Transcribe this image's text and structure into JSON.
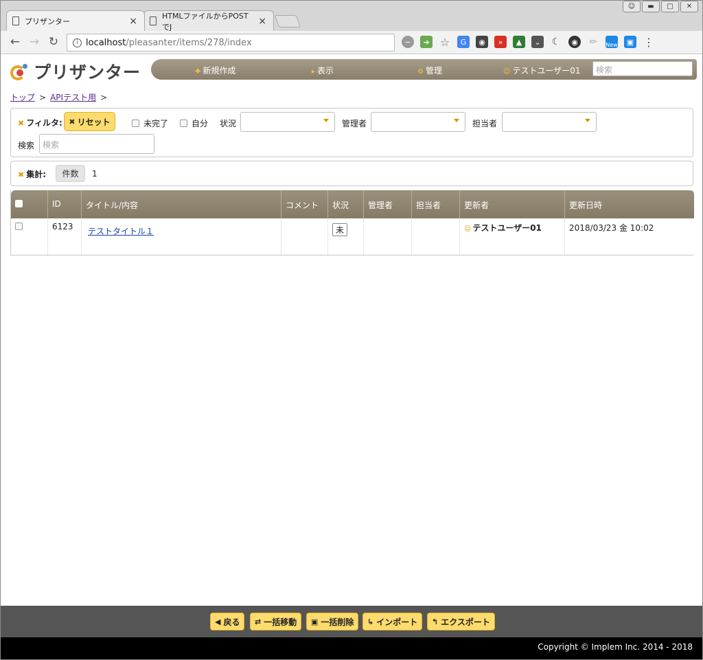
{
  "browser": {
    "tabs": [
      {
        "title": "プリザンター",
        "close": "×"
      },
      {
        "title": "HTMLファイルからPOSTでJ",
        "close": "×"
      }
    ],
    "url_host": "localhost",
    "url_path": "/pleasanter/items/278/index",
    "extensions": [
      {
        "icon": "dash-icon",
        "color": "#9a9a9a"
      },
      {
        "icon": "arrow-ext-icon",
        "color": "#6aa84f"
      },
      {
        "icon": "star-icon",
        "color": "#666666"
      },
      {
        "icon": "translate-icon",
        "color": "#4285f4"
      },
      {
        "icon": "keyhole-icon",
        "color": "#444444"
      },
      {
        "icon": "pocket-red-icon",
        "color": "#d93025"
      },
      {
        "icon": "usb-icon",
        "color": "#2e7d32"
      },
      {
        "icon": "pocket-icon",
        "color": "#555555"
      },
      {
        "icon": "moon-icon",
        "color": "#444444"
      },
      {
        "icon": "globe-icon",
        "color": "#333333"
      },
      {
        "icon": "pen-icon",
        "color": "#aaaaaa"
      },
      {
        "icon": "new-ext-icon",
        "color": "#1e88e5"
      },
      {
        "icon": "window-ext-icon",
        "color": "#1e88e5"
      }
    ],
    "new_badge": "New"
  },
  "app": {
    "logo_text": "プリザンター",
    "menu": {
      "new": "新規作成",
      "view": "表示",
      "manage": "管理",
      "user": "テストユーザー01",
      "search_placeholder": "検索"
    },
    "breadcrumb": {
      "top": "トップ",
      "site": "APIテスト用",
      "sep": ">"
    }
  },
  "filters": {
    "title": "フィルタ:",
    "reset": "リセット",
    "incomplete": "未完了",
    "own": "自分",
    "status_label": "状況",
    "manager_label": "管理者",
    "owner_label": "担当者",
    "search_label": "検索",
    "search_placeholder": "検索"
  },
  "aggregate": {
    "title": "集計:",
    "count_button": "件数",
    "count_value": "1"
  },
  "grid": {
    "columns": [
      "ID",
      "タイトル/内容",
      "コメント",
      "状況",
      "管理者",
      "担当者",
      "更新者",
      "更新日時"
    ],
    "rows": [
      {
        "id": "6123",
        "title": "テストタイトル１",
        "comment": "",
        "status": "未",
        "manager": "",
        "owner": "",
        "updator": "テストユーザー01",
        "updated": "2018/03/23 金 10:02"
      }
    ]
  },
  "footer": {
    "back": "戻る",
    "bulk_move": "一括移動",
    "bulk_delete": "一括削除",
    "import": "インポート",
    "export": "エクスポート",
    "copyright": "Copyright © Implem Inc. 2014 - 2018"
  },
  "colors": {
    "accent_yellow": "#fddb6d",
    "menu_brown": "#8a7f6b",
    "footer_gray": "#555555"
  }
}
